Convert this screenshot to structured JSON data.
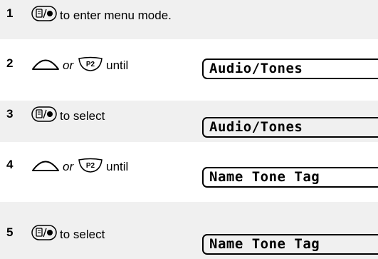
{
  "steps": [
    {
      "number": "1",
      "icon": "menu-select-button-icon",
      "text": "to enter menu mode."
    },
    {
      "number": "2",
      "icon": "up-arrow-key-icon",
      "or": "or",
      "icon2": "p2-button-icon",
      "text": "until",
      "display": "Audio/Tones"
    },
    {
      "number": "3",
      "icon": "menu-select-button-icon",
      "text": "to select",
      "display": "Audio/Tones"
    },
    {
      "number": "4",
      "icon": "up-arrow-key-icon",
      "or": "or",
      "icon2": "p2-button-icon",
      "text": "until",
      "display": "Name Tone Tag"
    },
    {
      "number": "5",
      "icon": "menu-select-button-icon",
      "text": "to select",
      "display": "Name Tone Tag"
    }
  ],
  "colors": {
    "shaded_band": "#f0f0f0"
  }
}
